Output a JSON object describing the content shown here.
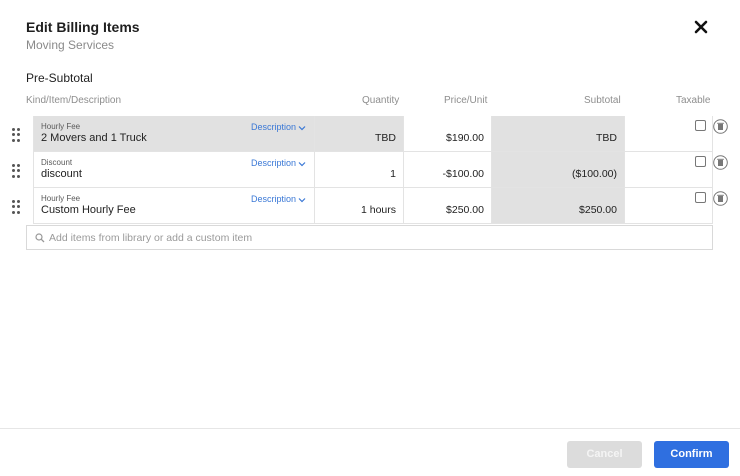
{
  "header": {
    "title": "Edit Billing Items",
    "subtitle": "Moving Services"
  },
  "section": {
    "title": "Pre-Subtotal"
  },
  "columns": {
    "kind": "Kind/Item/Description",
    "quantity": "Quantity",
    "price": "Price/Unit",
    "subtotal": "Subtotal",
    "taxable": "Taxable"
  },
  "rows": [
    {
      "kind": "Hourly Fee",
      "name": "2 Movers and 1 Truck",
      "description_label": "Description",
      "quantity": "TBD",
      "price": "$190.00",
      "subtotal": "TBD",
      "taxable": false
    },
    {
      "kind": "Discount",
      "name": "discount",
      "description_label": "Description",
      "quantity": "1",
      "price": "-$100.00",
      "subtotal": "($100.00)",
      "taxable": false
    },
    {
      "kind": "Hourly Fee",
      "name": "Custom Hourly Fee",
      "description_label": "Description",
      "quantity": "1 hours",
      "price": "$250.00",
      "subtotal": "$250.00",
      "taxable": false
    }
  ],
  "search": {
    "placeholder": "Add items from library or add a custom item",
    "value": ""
  },
  "footer": {
    "cancel_label": "Cancel",
    "confirm_label": "Confirm"
  },
  "colors": {
    "accent": "#2f6fe0",
    "link": "#3a78d6",
    "grey_cell": "#e1e1e1"
  }
}
